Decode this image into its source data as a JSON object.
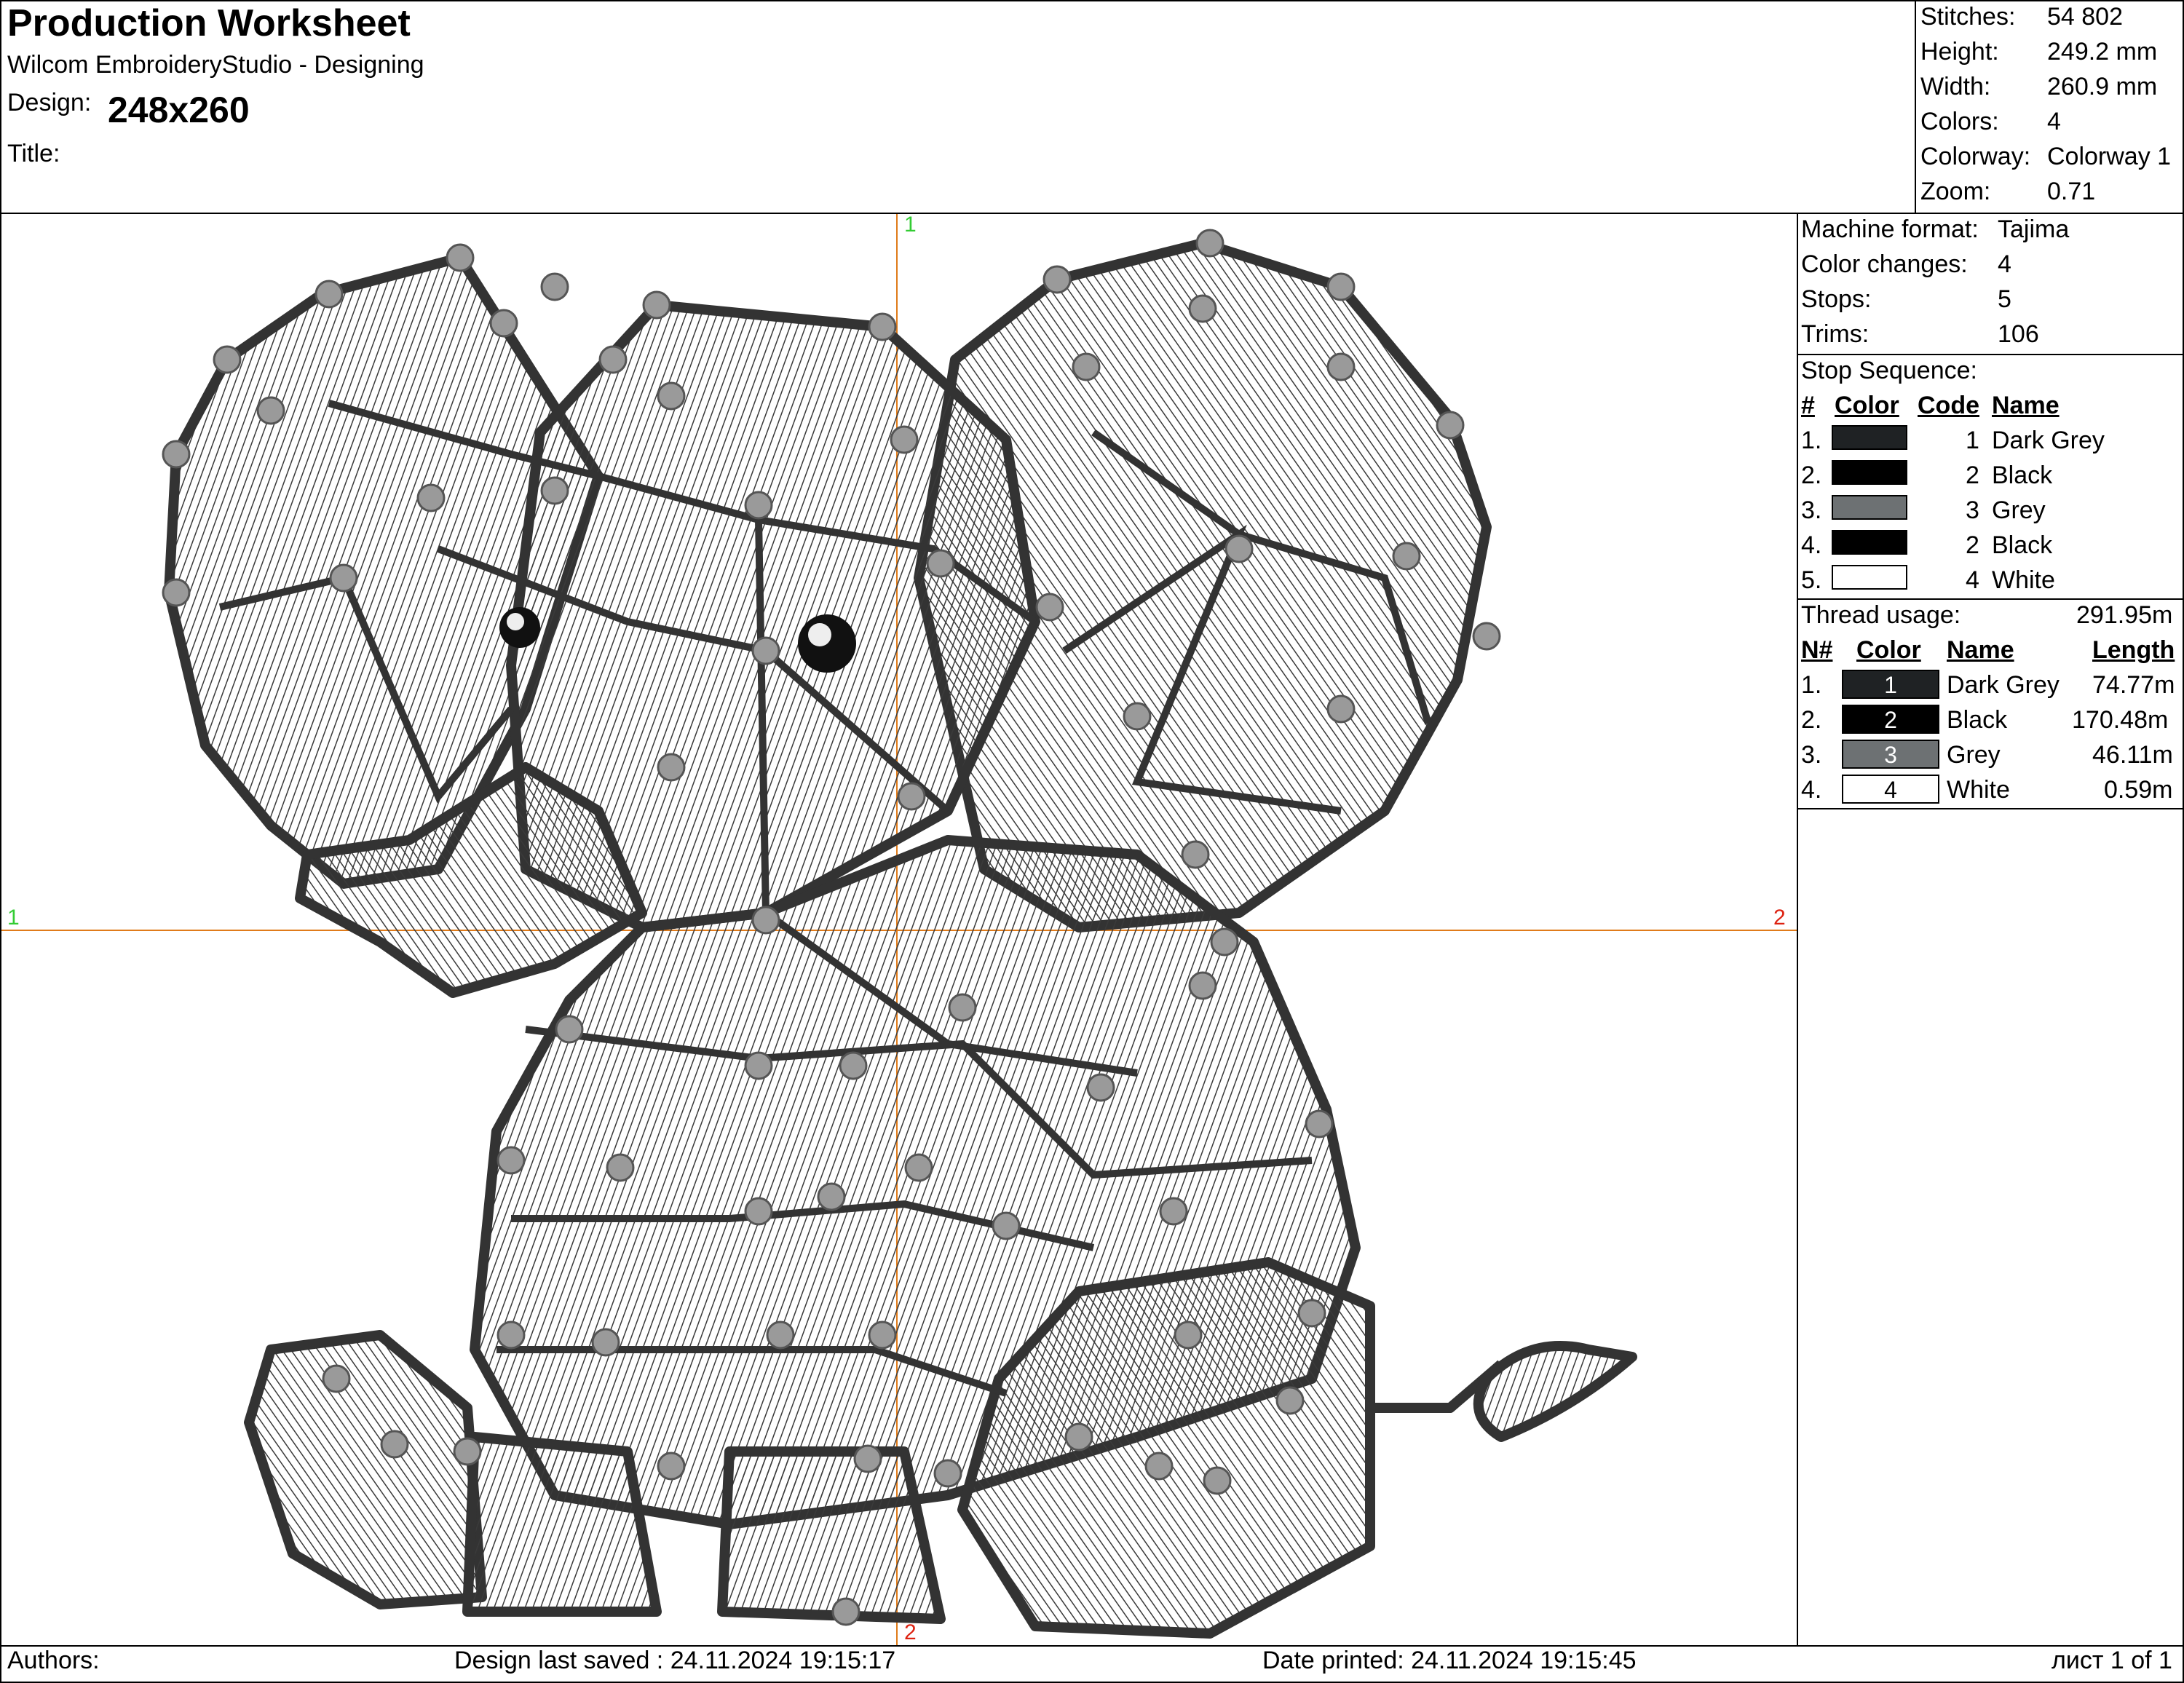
{
  "header": {
    "title": "Production Worksheet",
    "software": "Wilcom EmbroideryStudio - Designing",
    "design_label": "Design:",
    "design_value": "248x260",
    "title_label": "Title:"
  },
  "stats": [
    {
      "label": "Stitches:",
      "value": "54 802"
    },
    {
      "label": "Height:",
      "value": "249.2 mm"
    },
    {
      "label": "Width:",
      "value": "260.9 mm"
    },
    {
      "label": "Colors:",
      "value": "4"
    },
    {
      "label": "Colorway:",
      "value": "Colorway 1"
    },
    {
      "label": "Zoom:",
      "value": "0.71"
    }
  ],
  "machine": [
    {
      "label": "Machine format:",
      "value": "Tajima"
    },
    {
      "label": "Color changes:",
      "value": "4"
    },
    {
      "label": "Stops:",
      "value": "5"
    },
    {
      "label": "Trims:",
      "value": "106"
    }
  ],
  "stop_sequence": {
    "title": "Stop Sequence:",
    "headers": {
      "num": "#",
      "color": "Color",
      "code": "Code",
      "name": "Name"
    },
    "rows": [
      {
        "num": "1.",
        "color": "#1f2224",
        "code": "1",
        "name": "Dark Grey"
      },
      {
        "num": "2.",
        "color": "#000000",
        "code": "2",
        "name": "Black"
      },
      {
        "num": "3.",
        "color": "#6d7173",
        "code": "3",
        "name": "Grey"
      },
      {
        "num": "4.",
        "color": "#000000",
        "code": "2",
        "name": "Black"
      },
      {
        "num": "5.",
        "color": "#ffffff",
        "code": "4",
        "name": "White"
      }
    ]
  },
  "thread_usage": {
    "title": "Thread usage:",
    "total": "291.95m",
    "headers": {
      "num": "N#",
      "color": "Color",
      "name": "Name",
      "length": "Length"
    },
    "rows": [
      {
        "num": "1.",
        "color": "#1f2224",
        "code": "1",
        "name": "Dark Grey",
        "length": "74.77m"
      },
      {
        "num": "2.",
        "color": "#000000",
        "code": "2",
        "name": "Black",
        "length": "170.48m"
      },
      {
        "num": "3.",
        "color": "#6d7173",
        "code": "3",
        "name": "Grey",
        "length": "46.11m"
      },
      {
        "num": "4.",
        "color": "#ffffff",
        "code": "4",
        "name": "White",
        "length": "0.59m"
      }
    ]
  },
  "guides": {
    "top": "1",
    "bottom": "2",
    "left": "1",
    "right": "2"
  },
  "footer": {
    "authors": "Authors:",
    "saved": "Design last saved : 24.11.2024 19:15:17",
    "printed": "Date printed: 24.11.2024 19:15:45",
    "page": "лист 1 of 1"
  },
  "colors": {
    "guide": "#e07b1a",
    "guide_label_green": "#33cc33",
    "guide_label_red": "#dd2211"
  }
}
